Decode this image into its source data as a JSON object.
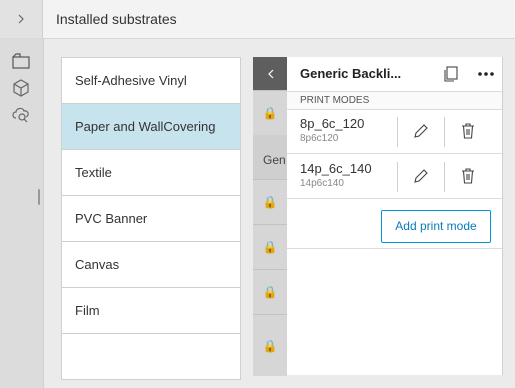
{
  "header": {
    "title": "Installed substrates"
  },
  "substrates": [
    {
      "label": "Self-Adhesive Vinyl",
      "selected": false
    },
    {
      "label": "Paper and WallCovering",
      "selected": true
    },
    {
      "label": "Textile",
      "selected": false
    },
    {
      "label": "PVC Banner",
      "selected": false
    },
    {
      "label": "Canvas",
      "selected": false
    },
    {
      "label": "Film",
      "selected": false
    },
    {
      "label": "",
      "selected": false
    }
  ],
  "strip": {
    "partial_label": "Gen"
  },
  "panel": {
    "title": "Generic Backli...",
    "section_label": "PRINT MODES",
    "print_modes": [
      {
        "name": "8p_6c_120",
        "id": "8p6c120"
      },
      {
        "name": "14p_6c_140",
        "id": "14p6c140"
      }
    ],
    "add_label": "Add print mode"
  },
  "colors": {
    "selected_row": "#c6e3ee",
    "accent": "#0096d6",
    "strip_header": "#5e5e5e"
  }
}
